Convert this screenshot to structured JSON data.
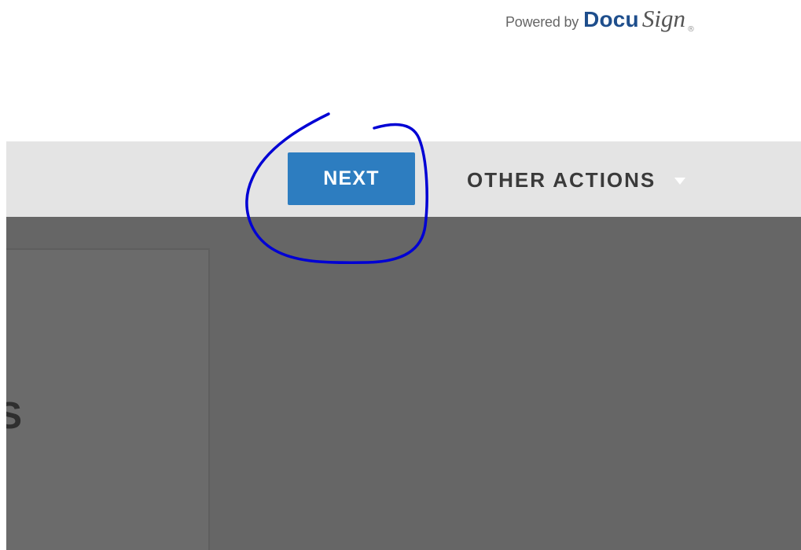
{
  "header": {
    "powered_by": "Powered by",
    "brand_docu": "Docu",
    "brand_sign": "Sign",
    "registered_mark": "®"
  },
  "toolbar": {
    "next_label": "NEXT",
    "other_actions_label": "OTHER ACTIONS",
    "caret_icon": "caret-down-icon"
  },
  "document": {
    "partial_text": "S"
  },
  "annotation": {
    "color": "#0000d4",
    "shape": "hand-drawn circle"
  },
  "colors": {
    "next_button": "#2d7dc0",
    "toolbar_background": "#e4e4e4",
    "document_background": "#666666",
    "brand_blue": "#1e4e8c"
  }
}
